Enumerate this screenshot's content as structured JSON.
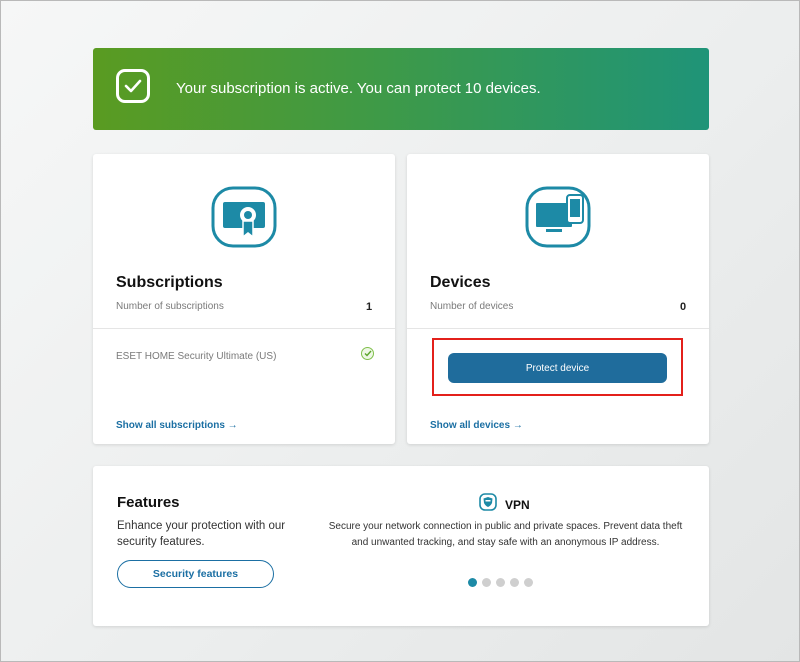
{
  "banner": {
    "message": "Your subscription is active. You can protect 10 devices."
  },
  "subscriptions": {
    "title": "Subscriptions",
    "count_label": "Number of subscriptions",
    "count": "1",
    "item": "ESET HOME Security Ultimate (US)",
    "link": "Show all subscriptions →",
    "icon": "certificate-icon"
  },
  "devices": {
    "title": "Devices",
    "count_label": "Number of devices",
    "count": "0",
    "button": "Protect device",
    "link": "Show all devices →",
    "icon": "monitor-phone-icon"
  },
  "features": {
    "title": "Features",
    "description": "Enhance your protection with our security features.",
    "button": "Security features",
    "carousel": {
      "current_title": "VPN",
      "current_description": "Secure your network connection in public and private spaces. Prevent data theft and unwanted tracking, and stay safe with an anonymous IP address.",
      "total_slides": 5,
      "active_slide": 1
    }
  },
  "colors": {
    "accent": "#1f6c9c",
    "teal": "#1d8aa6",
    "highlight": "#e3201b",
    "banner_start": "#5a9b21",
    "banner_end": "#1f9478"
  }
}
